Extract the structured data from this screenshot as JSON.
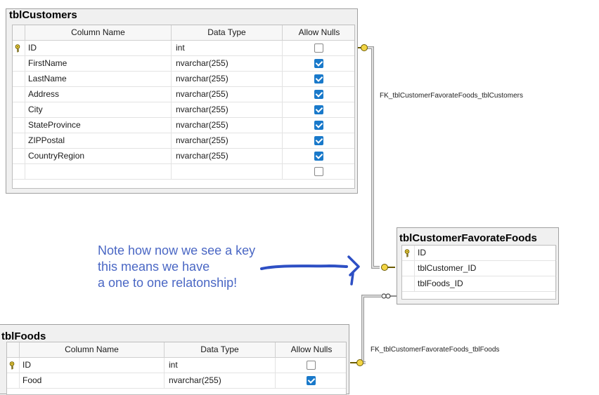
{
  "tables": [
    {
      "name": "tblCustomers",
      "headers": {
        "column_name": "Column Name",
        "data_type": "Data Type",
        "allow_nulls": "Allow Nulls"
      },
      "rows": [
        {
          "key": true,
          "column": "ID",
          "type": "int",
          "nulls": false
        },
        {
          "key": false,
          "column": "FirstName",
          "type": "nvarchar(255)",
          "nulls": true
        },
        {
          "key": false,
          "column": "LastName",
          "type": "nvarchar(255)",
          "nulls": true
        },
        {
          "key": false,
          "column": "Address",
          "type": "nvarchar(255)",
          "nulls": true
        },
        {
          "key": false,
          "column": "City",
          "type": "nvarchar(255)",
          "nulls": true
        },
        {
          "key": false,
          "column": "StateProvince",
          "type": "nvarchar(255)",
          "nulls": true
        },
        {
          "key": false,
          "column": "ZIPPostal",
          "type": "nvarchar(255)",
          "nulls": true
        },
        {
          "key": false,
          "column": "CountryRegion",
          "type": "nvarchar(255)",
          "nulls": true
        },
        {
          "key": false,
          "column": "",
          "type": "",
          "nulls": false
        }
      ]
    },
    {
      "name": "tblCustomerFavorateFoods",
      "rows": [
        {
          "key": true,
          "column": "ID"
        },
        {
          "key": false,
          "column": "tblCustomer_ID"
        },
        {
          "key": false,
          "column": "tblFoods_ID"
        }
      ]
    },
    {
      "name": "tblFoods",
      "headers": {
        "column_name": "Column Name",
        "data_type": "Data Type",
        "allow_nulls": "Allow Nulls"
      },
      "rows": [
        {
          "key": true,
          "column": "ID",
          "type": "int",
          "nulls": false
        },
        {
          "key": false,
          "column": "Food",
          "type": "nvarchar(255)",
          "nulls": true
        }
      ]
    }
  ],
  "relationships": [
    {
      "label": "FK_tblCustomerFavorateFoods_tblCustomers"
    },
    {
      "label": "FK_tblCustomerFavorateFoods_tblFoods"
    }
  ],
  "annotation": {
    "lines": [
      "Note how now we see a key",
      "this means we have",
      "a one to one relatonship!"
    ],
    "color": "#4a67c4"
  },
  "colors": {
    "checkbox_checked": "#1979ca",
    "key": "#d4b21c",
    "arrow": "#2d4fc4"
  },
  "icons": {
    "primary_key": "key-icon",
    "checked": "checkbox-checked",
    "unchecked": "checkbox-unchecked"
  }
}
